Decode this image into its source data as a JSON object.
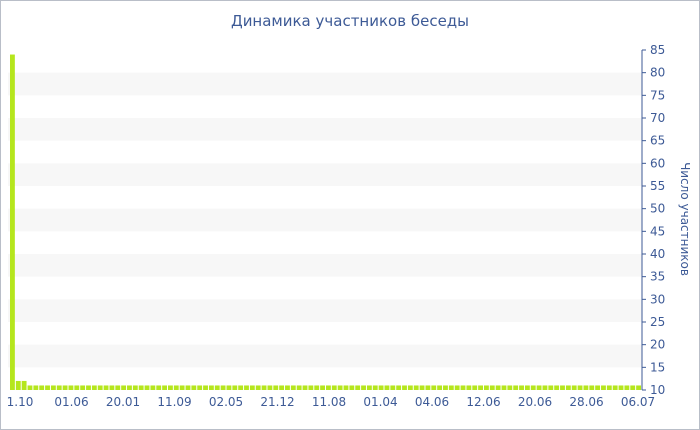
{
  "chart_data": {
    "type": "bar",
    "title": "Динамика участников беседы",
    "xlabel": "",
    "ylabel": "Число участников",
    "ylim": [
      10,
      85
    ],
    "y_ticks": [
      10,
      15,
      20,
      25,
      30,
      35,
      40,
      45,
      50,
      55,
      60,
      65,
      70,
      75,
      80,
      85
    ],
    "y_axis_position": "right",
    "bar_color": "#b5e61d",
    "band_color": "#f7f7f7",
    "x_tick_labels": [
      "1.10",
      "01.06",
      "20.01",
      "11.09",
      "02.05",
      "21.12",
      "11.08",
      "01.04",
      "04.06",
      "12.06",
      "20.06",
      "28.06",
      "06.07"
    ],
    "values": [
      84,
      12,
      12,
      11,
      11,
      11,
      11,
      11,
      11,
      11,
      11,
      11,
      11,
      11,
      11,
      11,
      11,
      11,
      11,
      11,
      11,
      11,
      11,
      11,
      11,
      11,
      11,
      11,
      11,
      11,
      11,
      11,
      11,
      11,
      11,
      11,
      11,
      11,
      11,
      11,
      11,
      11,
      11,
      11,
      11,
      11,
      11,
      11,
      11,
      11,
      11,
      11,
      11,
      11,
      11,
      11,
      11,
      11,
      11,
      11,
      11,
      11,
      11,
      11,
      11,
      11,
      11,
      11,
      11,
      11,
      11,
      11,
      11,
      11,
      11,
      11,
      11,
      11,
      11,
      11,
      11,
      11,
      11,
      11,
      11,
      11,
      11,
      11,
      11,
      11,
      11,
      11,
      11,
      11,
      11,
      11,
      11,
      11,
      11,
      11,
      11,
      11,
      11,
      11,
      11,
      11,
      11,
      11
    ]
  }
}
